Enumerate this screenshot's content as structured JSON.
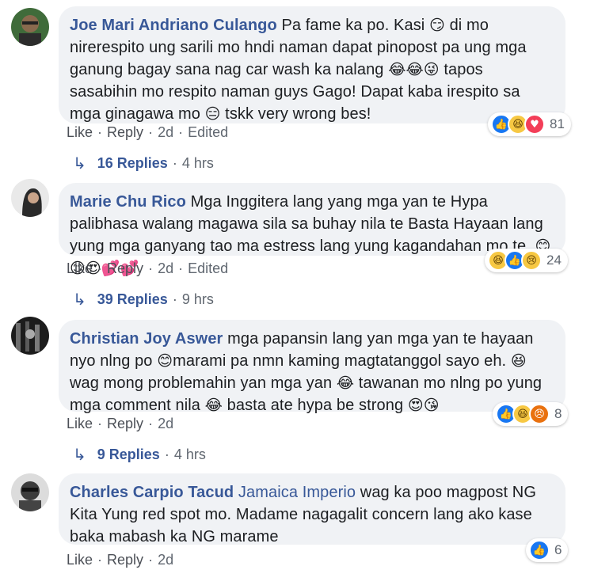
{
  "comments": [
    {
      "author": "Joe Mari Andriano Culango",
      "text_parts": [
        "Pa fame ka po. Kasi ",
        "😏",
        " di mo nirerespito ung sarili mo hndi naman dapat pinopost pa ung mga ganung bagay sana nag car wash ka nalang ",
        "😂😂😜",
        " tapos sasabihin mo respito naman guys Gago! Dapat kaba irespito sa mga ginagawa mo ",
        "😑",
        " tskk very wrong bes!"
      ],
      "reactions": [
        "like",
        "haha",
        "love"
      ],
      "reaction_count": "81",
      "actions": {
        "like": "Like",
        "reply": "Reply",
        "time": "2d",
        "edited": "Edited"
      },
      "replies": {
        "count": "16 Replies",
        "time": "4 hrs"
      }
    },
    {
      "author": "Marie Chu Rico",
      "text_parts": [
        "Mga Inggitera lang yang mga yan te Hypa palibhasa walang magawa sila sa buhay nila te Basta Hayaan lang yung mga ganyang tao ma estress lang yung kagandahan mo te .",
        "😊😊😍💕💕"
      ],
      "reactions": [
        "haha",
        "like",
        "sad"
      ],
      "reaction_count": "24",
      "actions": {
        "like": "Like",
        "reply": "Reply",
        "time": "2d",
        "edited": "Edited"
      },
      "replies": {
        "count": "39 Replies",
        "time": "9 hrs"
      }
    },
    {
      "author": "Christian Joy Aswer",
      "text_parts": [
        "mga papansin lang yan mga yan te hayaan nyo nlng po ",
        "😊",
        "marami pa nmn kaming magtatanggol sayo eh. ",
        "😆",
        " wag mong problemahin yan mga yan ",
        "😂",
        " tawanan mo nlng po yung mga comment nila ",
        "😂",
        " basta ate hypa be strong ",
        "😍😘"
      ],
      "reactions": [
        "like",
        "haha",
        "angry"
      ],
      "reaction_count": "8",
      "actions": {
        "like": "Like",
        "reply": "Reply",
        "time": "2d",
        "edited": ""
      },
      "replies": {
        "count": "9 Replies",
        "time": "4 hrs"
      }
    },
    {
      "author": "Charles Carpio Tacud",
      "mention": "Jamaica Imperio",
      "text_parts": [
        " wag ka poo magpost NG Kita Yung red spot mo. Madame nagagalit concern lang ako kase baka mabash ka NG marame"
      ],
      "reactions": [
        "like"
      ],
      "reaction_count": "6",
      "actions": {
        "like": "Like",
        "reply": "Reply",
        "time": "2d",
        "edited": ""
      },
      "replies": null
    }
  ],
  "icons": {
    "like": "thumbs-up-icon",
    "haha": "laughing-face-icon",
    "love": "heart-icon",
    "sad": "sad-face-icon",
    "angry": "angry-face-icon",
    "reply_arrow": "reply-arrow-icon"
  },
  "colors": {
    "link": "#385898",
    "bubble_bg": "#f0f2f5",
    "meta_text": "#606770",
    "like_blue": "#1877f2",
    "love_red": "#f33e58",
    "haha_yellow": "#f7c843",
    "angry_orange": "#e9710f"
  }
}
